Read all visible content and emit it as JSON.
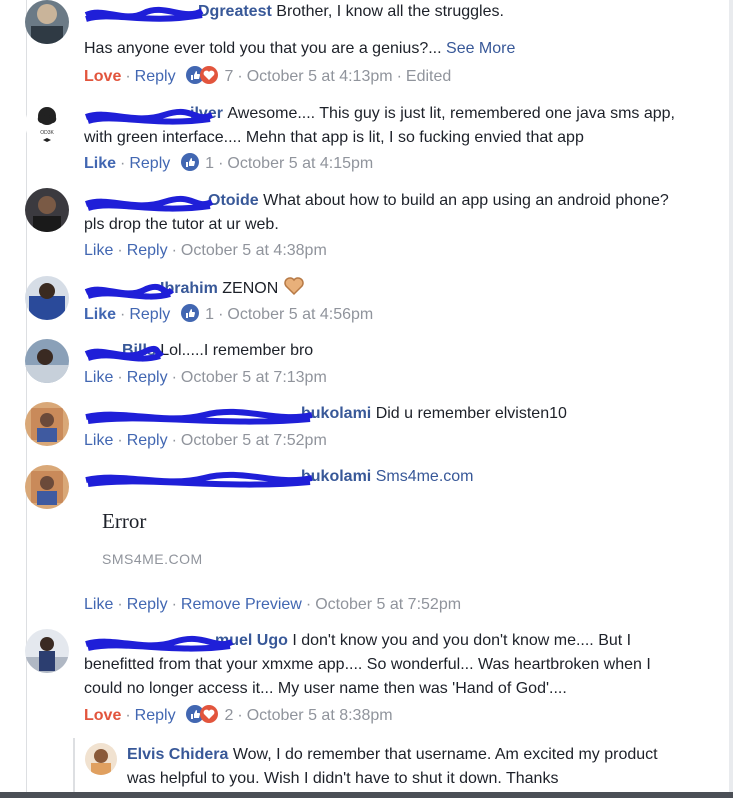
{
  "colors": {
    "link": "#385898",
    "action": "#4267b2",
    "meta": "#90949c",
    "love": "#e2553d",
    "redaction": "#1f1fd8"
  },
  "comments": [
    {
      "name": "Dgreatest",
      "lines": [
        "Brother, I know all the struggles.",
        "Has anyone ever told you that you are a genius?..."
      ],
      "see_more": "See More",
      "action_label": "Love",
      "reply": "Reply",
      "reactions": [
        "like-icon",
        "love-icon"
      ],
      "count": "7",
      "time": "October 5 at 4:13pm",
      "edited": "Edited"
    },
    {
      "name": "ilver",
      "text": "Awesome.... This guy is just lit, remembered one java sms app, with green interface.... Mehn that app is lit, I so fucking envied that app",
      "action_label": "Like",
      "reply": "Reply",
      "reactions": [
        "like-icon"
      ],
      "count": "1",
      "time": "October 5 at 4:15pm"
    },
    {
      "name": "Otoide",
      "text": "What about how to build an app using an android phone? pls drop the tutor at ur web.",
      "action_label": "Like",
      "reply": "Reply",
      "time": "October 5 at 4:38pm"
    },
    {
      "name": "Ibrahim",
      "text": "ZENON",
      "action_label": "Like",
      "reply": "Reply",
      "reactions": [
        "like-icon"
      ],
      "count": "1",
      "time": "October 5 at 4:56pm"
    },
    {
      "name": "Bills",
      "text": "Lol.....I remember bro",
      "action_label": "Like",
      "reply": "Reply",
      "time": "October 5 at 7:13pm"
    },
    {
      "name": "bukolami",
      "text": "Did u remember elvisten10",
      "action_label": "Like",
      "reply": "Reply",
      "time": "October 5 at 7:52pm"
    },
    {
      "name": "bukolami",
      "link_text": "Sms4me.com",
      "preview_title": "Error",
      "preview_domain": "SMS4ME.COM",
      "action_label": "Like",
      "reply": "Reply",
      "remove_preview": "Remove Preview",
      "time": "October 5 at 7:52pm"
    },
    {
      "name": "muel Ugo",
      "text": "I don't know you and you don't know me.... But I benefitted from that your xmxme app.... So wonderful... Was heartbroken when I could no longer access it... My user name then was 'Hand of God'....",
      "action_label": "Love",
      "reply": "Reply",
      "reactions": [
        "like-icon",
        "love-icon"
      ],
      "count": "2",
      "time": "October 5 at 8:38pm"
    }
  ],
  "reply": {
    "name": "Elvis Chidera",
    "text": "Wow, I do remember that username. Am excited my product was helpful to you. Wish I didn't have to shut it down. Thanks"
  }
}
